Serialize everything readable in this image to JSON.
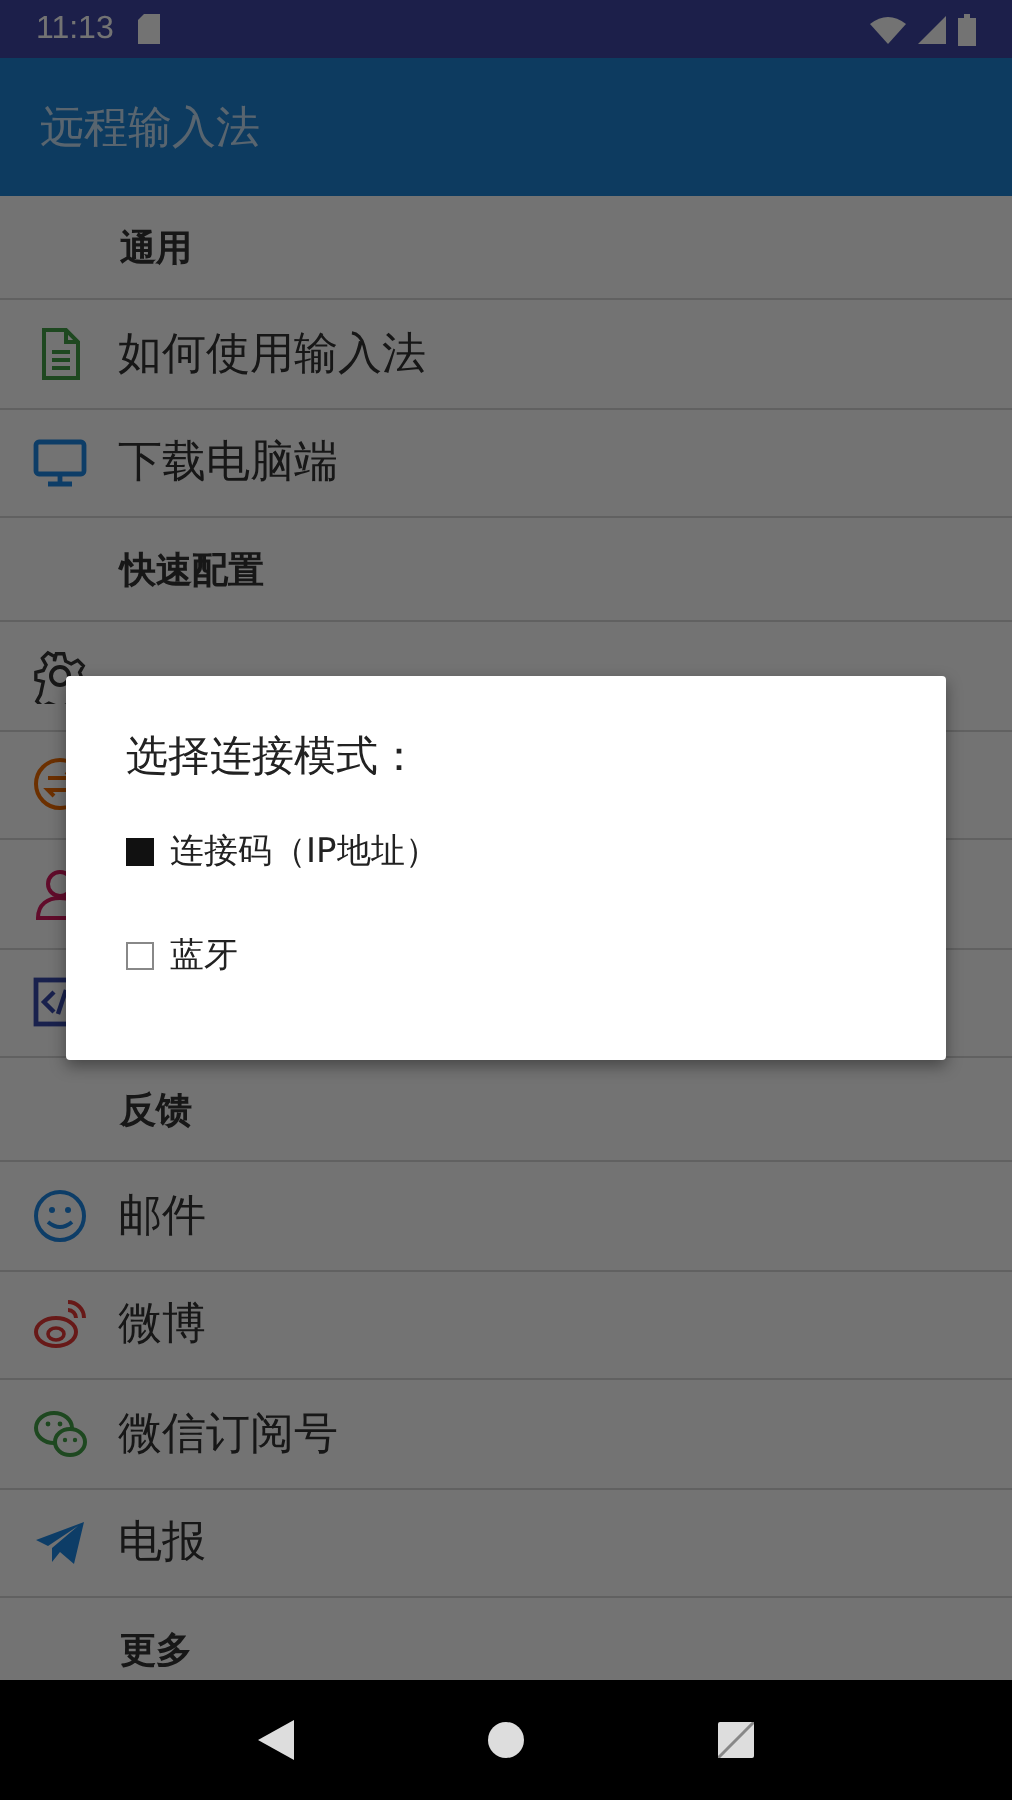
{
  "status_bar": {
    "time": "11:13"
  },
  "app_bar": {
    "title": "远程输入法"
  },
  "sections": [
    {
      "header": "通用",
      "items": [
        {
          "kind": "document",
          "label": "如何使用输入法"
        },
        {
          "kind": "monitor",
          "label": "下载电脑端"
        }
      ]
    },
    {
      "header": "快速配置",
      "items": [
        {
          "kind": "gear"
        },
        {
          "kind": "switch"
        },
        {
          "kind": "person"
        },
        {
          "kind": "code"
        }
      ]
    },
    {
      "header": "反馈",
      "items": [
        {
          "kind": "smile",
          "label": "邮件"
        },
        {
          "kind": "weibo",
          "label": "微博"
        },
        {
          "kind": "wechat",
          "label": "微信订阅号"
        },
        {
          "kind": "telegram",
          "label": "电报"
        }
      ]
    },
    {
      "header": "更多"
    }
  ],
  "dialog": {
    "title": "选择连接模式：",
    "options": [
      {
        "label": "连接码（IP地址）",
        "selected": true
      },
      {
        "label": "蓝牙",
        "selected": false
      }
    ]
  }
}
